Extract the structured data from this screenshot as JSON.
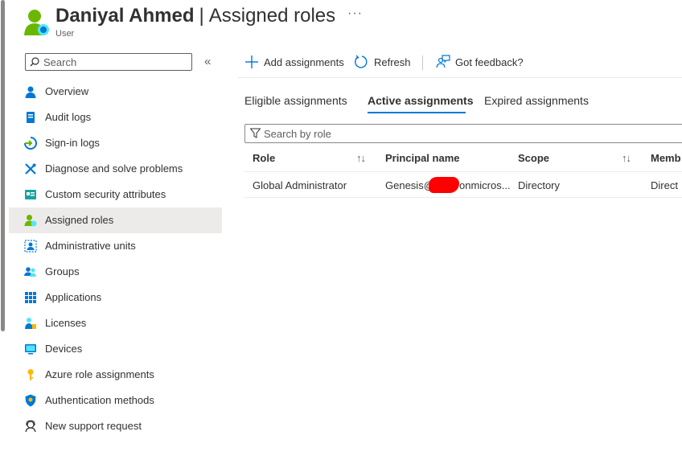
{
  "header": {
    "user_name": "Daniyal Ahmed",
    "separator": "|",
    "page_title": "Assigned roles",
    "subtitle": "User",
    "more_label": "···"
  },
  "sidebar": {
    "search": {
      "placeholder": "Search"
    },
    "collapse_glyph": "«",
    "items": [
      {
        "label": "Overview",
        "icon": "user-icon"
      },
      {
        "label": "Audit logs",
        "icon": "book-icon"
      },
      {
        "label": "Sign-in logs",
        "icon": "sign-in-icon"
      },
      {
        "label": "Diagnose and solve problems",
        "icon": "wrench-icon"
      },
      {
        "label": "Custom security attributes",
        "icon": "attributes-icon"
      },
      {
        "label": "Assigned roles",
        "icon": "user-role-icon",
        "active": true
      },
      {
        "label": "Administrative units",
        "icon": "admin-units-icon"
      },
      {
        "label": "Groups",
        "icon": "groups-icon"
      },
      {
        "label": "Applications",
        "icon": "apps-grid-icon"
      },
      {
        "label": "Licenses",
        "icon": "license-icon"
      },
      {
        "label": "Devices",
        "icon": "device-icon"
      },
      {
        "label": "Azure role assignments",
        "icon": "key-icon"
      },
      {
        "label": "Authentication methods",
        "icon": "shield-icon"
      },
      {
        "label": "New support request",
        "icon": "support-icon"
      }
    ]
  },
  "toolbar": {
    "add_assignments": "Add assignments",
    "refresh": "Refresh",
    "feedback": "Got feedback?"
  },
  "tabs": [
    {
      "label": "Eligible assignments"
    },
    {
      "label": "Active assignments",
      "active": true
    },
    {
      "label": "Expired assignments"
    }
  ],
  "role_search": {
    "placeholder": "Search by role"
  },
  "table": {
    "columns": [
      "Role",
      "Principal name",
      "Scope",
      "Memb"
    ],
    "sort_glyph": "↑↓",
    "rows": [
      {
        "role": "Global Administrator",
        "principal_prefix": "Genesis@",
        "principal_suffix": "onmicros...",
        "scope": "Directory",
        "membership": "Direct"
      }
    ]
  },
  "colors": {
    "accent": "#0078d4",
    "selected_nav": "#edebe9",
    "redaction": "#ff0000"
  }
}
